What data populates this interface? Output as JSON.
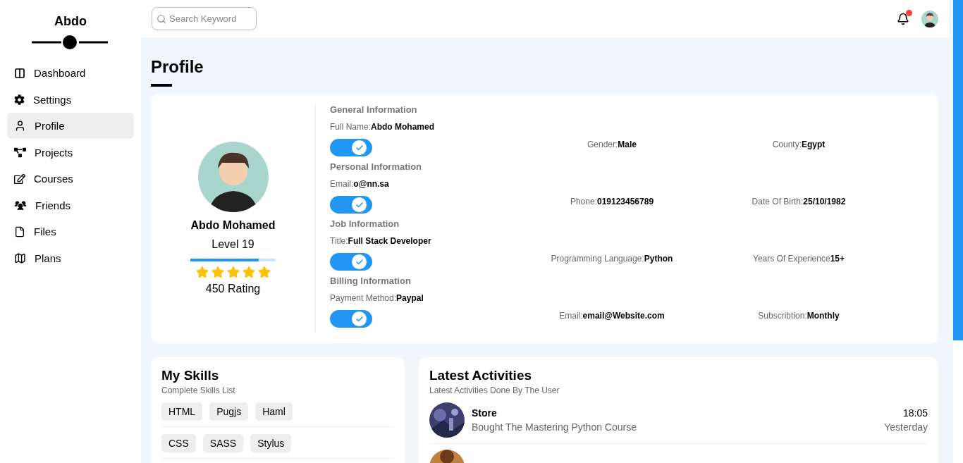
{
  "sidebar": {
    "brand": "Abdo",
    "items": [
      {
        "label": "Dashboard",
        "selected": false
      },
      {
        "label": "Settings",
        "selected": false
      },
      {
        "label": "Profile",
        "selected": true
      },
      {
        "label": "Projects",
        "selected": false
      },
      {
        "label": "Courses",
        "selected": false
      },
      {
        "label": "Friends",
        "selected": false
      },
      {
        "label": "Files",
        "selected": false
      },
      {
        "label": "Plans",
        "selected": false
      }
    ]
  },
  "header": {
    "search": {
      "placeholder": "Search Keyword"
    },
    "notifications": {
      "unread": true
    }
  },
  "page_title": "Profile",
  "profile": {
    "name": "Abdo Mohamed",
    "level_text": "Level 19",
    "level": 0.8,
    "stars": 5,
    "rating": "450 Rating"
  },
  "info_sections": [
    {
      "title": "General Information",
      "enabled": true,
      "fields": [
        {
          "label": "Full Name:",
          "value": "Abdo Mohamed"
        },
        {
          "label": "Gender:",
          "value": "Male"
        },
        {
          "label": "County:",
          "value": "Egypt"
        }
      ]
    },
    {
      "title": "Personal Information",
      "enabled": true,
      "fields": [
        {
          "label": "Email:",
          "value": "o@nn.sa"
        },
        {
          "label": "Phone:",
          "value": "019123456789"
        },
        {
          "label": "Date Of Birth:",
          "value": "25/10/1982"
        }
      ]
    },
    {
      "title": "Job Information",
      "enabled": true,
      "fields": [
        {
          "label": "Title:",
          "value": "Full Stack Developer"
        },
        {
          "label": "Programming Language:",
          "value": "Python"
        },
        {
          "label": "Years Of Experience",
          "value": "15+"
        }
      ]
    },
    {
      "title": "Billing Information",
      "enabled": true,
      "fields": [
        {
          "label": "Payment Method:",
          "value": "Paypal"
        },
        {
          "label": "Email:",
          "value": "email@Website.com"
        },
        {
          "label": "Subscribtion:",
          "value": "Monthly"
        }
      ]
    }
  ],
  "skills": {
    "title": "My Skills",
    "subtitle": "Complete Skills List",
    "rows": [
      [
        "HTML",
        "Pugjs",
        "Haml"
      ],
      [
        "CSS",
        "SASS",
        "Stylus"
      ]
    ]
  },
  "activities": {
    "title": "Latest Activities",
    "subtitle": "Latest Activities Done By The User",
    "items": [
      {
        "kind": "entry",
        "title": "Store",
        "description": "Bought The Mastering Python Course",
        "time": "18:05",
        "day": "Yesterday"
      },
      {
        "kind": "picture"
      }
    ]
  }
}
